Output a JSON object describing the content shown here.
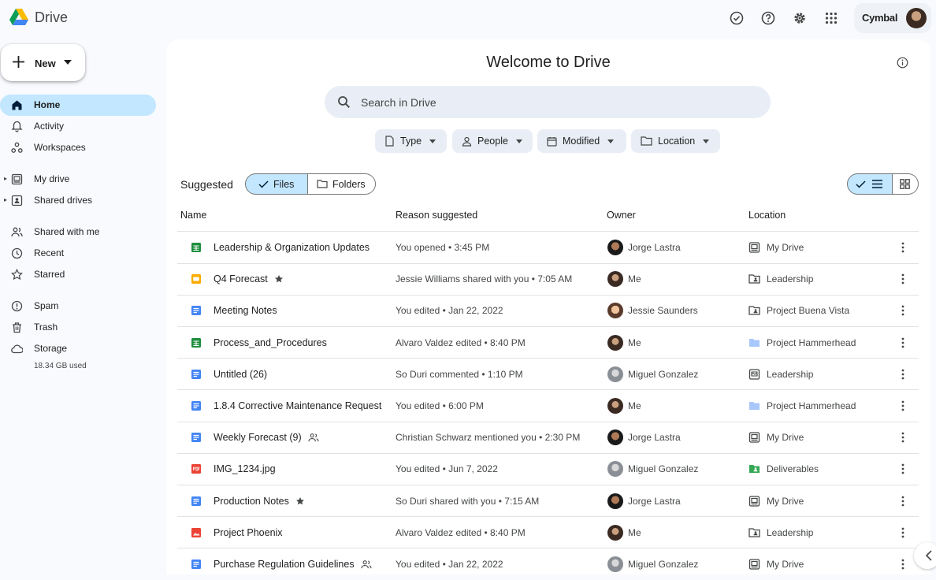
{
  "app": {
    "name": "Drive",
    "account": "Cymbal"
  },
  "top_icons": [
    "ready-for-offline-icon",
    "help-icon",
    "settings-icon",
    "apps-grid-icon"
  ],
  "new_button": {
    "label": "New"
  },
  "nav": [
    {
      "label": "Home",
      "icon": "home-icon",
      "active": true
    },
    {
      "label": "Activity",
      "icon": "bell-icon"
    },
    {
      "label": "Workspaces",
      "icon": "workspaces-icon"
    },
    {
      "label": "My drive",
      "icon": "my-drive-icon",
      "expandable": true
    },
    {
      "label": "Shared drives",
      "icon": "shared-drives-icon",
      "expandable": true
    },
    {
      "label": "Shared with me",
      "icon": "people-icon"
    },
    {
      "label": "Recent",
      "icon": "clock-icon"
    },
    {
      "label": "Starred",
      "icon": "star-icon"
    },
    {
      "label": "Spam",
      "icon": "spam-icon"
    },
    {
      "label": "Trash",
      "icon": "trash-icon"
    },
    {
      "label": "Storage",
      "icon": "cloud-icon"
    }
  ],
  "storage_used": "18.34 GB used",
  "main": {
    "title": "Welcome to Drive",
    "search_placeholder": "Search in Drive",
    "filters": [
      "Type",
      "People",
      "Modified",
      "Location"
    ],
    "suggested_label": "Suggested",
    "toggle": {
      "files": "Files",
      "folders": "Folders",
      "selected": "Files"
    },
    "view": "list",
    "columns": {
      "name": "Name",
      "reason": "Reason suggested",
      "owner": "Owner",
      "location": "Location"
    },
    "rows": [
      {
        "name": "Leadership & Organization Updates",
        "type": "sheets",
        "reason": "You opened • 3:45 PM",
        "owner": "Jorge Lastra",
        "location": "My Drive",
        "loc_icon": "my-drive"
      },
      {
        "name": "Q4 Forecast",
        "type": "slides",
        "starred": true,
        "reason": "Jessie Williams shared with you • 7:05 AM",
        "owner": "Me",
        "location": "Leadership",
        "loc_icon": "shared-folder"
      },
      {
        "name": "Meeting Notes",
        "type": "docs",
        "reason": "You edited • Jan 22, 2022",
        "owner": "Jessie Saunders",
        "location": "Project Buena Vista",
        "loc_icon": "shared-folder"
      },
      {
        "name": "Process_and_Procedures",
        "type": "sheets",
        "reason": "Alvaro Valdez edited • 8:40 PM",
        "owner": "Me",
        "location": "Project Hammerhead",
        "loc_icon": "blue-folder"
      },
      {
        "name": "Untitled (26)",
        "type": "docs",
        "reason": "So Duri commented • 1:10 PM",
        "owner": "Miguel Gonzalez",
        "location": "Leadership",
        "loc_icon": "shared-drive"
      },
      {
        "name": "1.8.4 Corrective Maintenance Request",
        "type": "docs",
        "reason": "You edited • 6:00 PM",
        "owner": "Me",
        "location": "Project Hammerhead",
        "loc_icon": "blue-folder"
      },
      {
        "name": "Weekly Forecast (9)",
        "type": "docs",
        "shared": true,
        "reason": "Christian Schwarz mentioned you • 2:30 PM",
        "owner": "Jorge Lastra",
        "location": "My Drive",
        "loc_icon": "my-drive"
      },
      {
        "name": "IMG_1234.jpg",
        "type": "pdf",
        "reason": "You edited • Jun 7, 2022",
        "owner": "Miguel Gonzalez",
        "location": "Deliverables",
        "loc_icon": "green-folder"
      },
      {
        "name": "Production Notes",
        "type": "docs",
        "starred": true,
        "reason": "So Duri shared with you • 7:15 AM",
        "owner": "Jorge Lastra",
        "location": "My Drive",
        "loc_icon": "my-drive"
      },
      {
        "name": "Project Phoenix",
        "type": "image",
        "reason": "Alvaro Valdez edited • 8:40 PM",
        "owner": "Me",
        "location": "Leadership",
        "loc_icon": "shared-folder"
      },
      {
        "name": "Purchase Regulation Guidelines",
        "type": "docs",
        "shared": true,
        "reason": "You edited • Jan 22, 2022",
        "owner": "Miguel Gonzalez",
        "location": "My Drive",
        "loc_icon": "my-drive"
      }
    ]
  },
  "colors": {
    "accent": "#c2e7ff",
    "sheets": "#1e8e3e",
    "slides": "#f9ab00",
    "docs": "#4285f4",
    "pdf": "#ea4335",
    "folder_blue": "#a8c7fa",
    "folder_green": "#34a853"
  }
}
